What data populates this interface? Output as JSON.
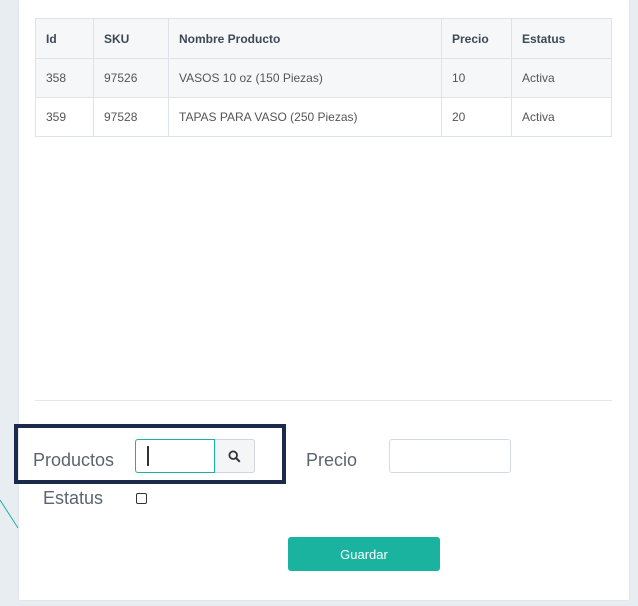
{
  "table": {
    "headers": [
      "Id",
      "SKU",
      "Nombre Producto",
      "Precio",
      "Estatus"
    ],
    "rows": [
      [
        "358",
        "97526",
        "VASOS 10 oz (150 Piezas)",
        "10",
        "Activa"
      ],
      [
        "359",
        "97528",
        "TAPAS PARA VASO (250 Piezas)",
        "20",
        "Activa"
      ]
    ]
  },
  "form": {
    "productos_label": "Productos",
    "productos_value": "",
    "search_icon": "search-icon",
    "precio_label": "Precio",
    "precio_value": "",
    "estatus_label": "Estatus",
    "estatus_checked": false,
    "save_label": "Guardar"
  },
  "colors": {
    "accent": "#1ab3a0",
    "highlight_border": "#1b2a4a"
  }
}
